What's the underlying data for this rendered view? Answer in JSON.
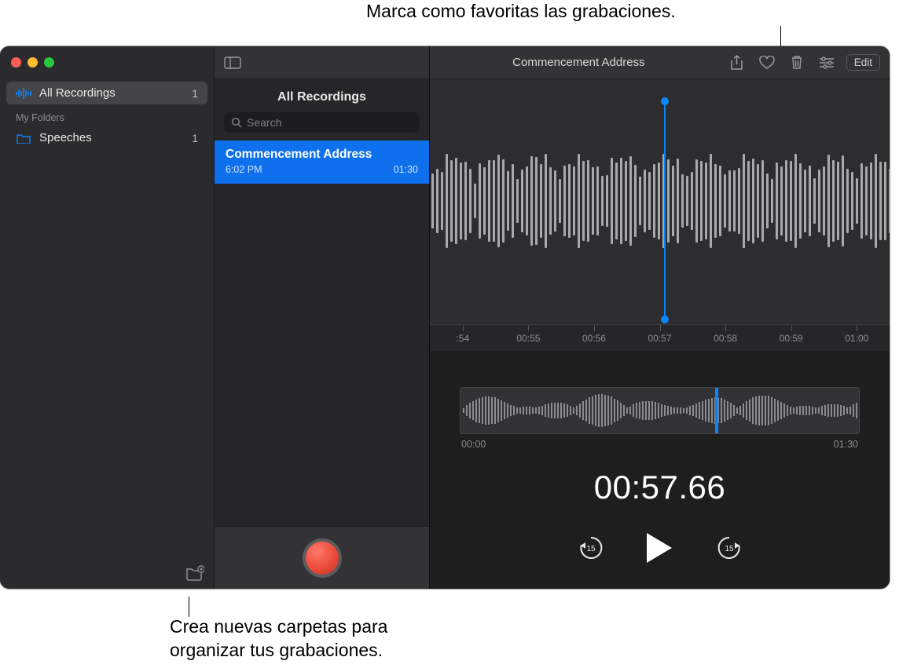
{
  "callouts": {
    "top": "Marca como favoritas las grabaciones.",
    "bottom_line1": "Crea nuevas carpetas para",
    "bottom_line2": "organizar tus grabaciones."
  },
  "sidebar": {
    "all_recordings": {
      "label": "All Recordings",
      "count": "1"
    },
    "section_heading": "My Folders",
    "folders": [
      {
        "label": "Speeches",
        "count": "1"
      }
    ]
  },
  "mid": {
    "title": "All Recordings",
    "search_placeholder": "Search",
    "recordings": [
      {
        "title": "Commencement Address",
        "time": "6:02 PM",
        "duration": "01:30"
      }
    ]
  },
  "toolbar": {
    "title": "Commencement Address",
    "edit_label": "Edit"
  },
  "ruler_labels": [
    ":54",
    "00:55",
    "00:56",
    "00:57",
    "00:58",
    "00:59",
    "01:00"
  ],
  "overview": {
    "start": "00:00",
    "end": "01:30"
  },
  "timecode": "00:57.66",
  "transport": {
    "back": "15",
    "fwd": "15"
  },
  "colors": {
    "accent": "#0a84ff",
    "record": "#ec4a3a"
  }
}
